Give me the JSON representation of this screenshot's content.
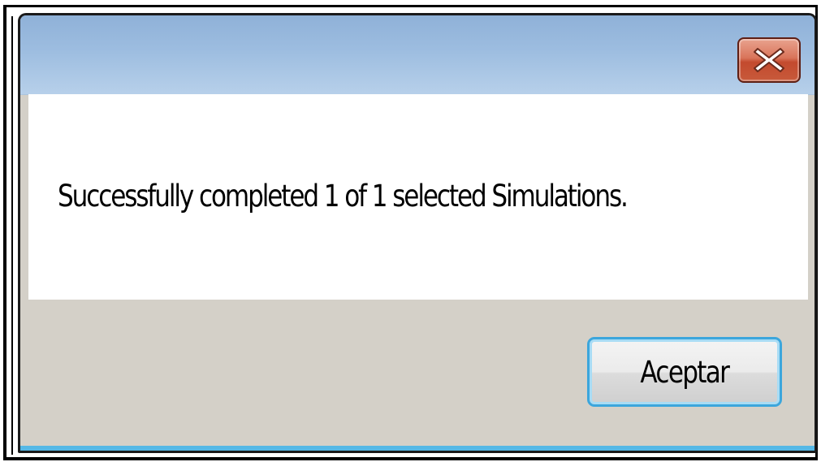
{
  "dialog": {
    "close_icon": "close-icon",
    "message": "Successfully completed 1 of 1 selected Simulations.",
    "accept_label": "Aceptar"
  },
  "colors": {
    "titlebar": "#9dbde0",
    "close_button": "#c85a3b",
    "body": "#d4d0c8",
    "button_focus": "#3ca6dc"
  }
}
